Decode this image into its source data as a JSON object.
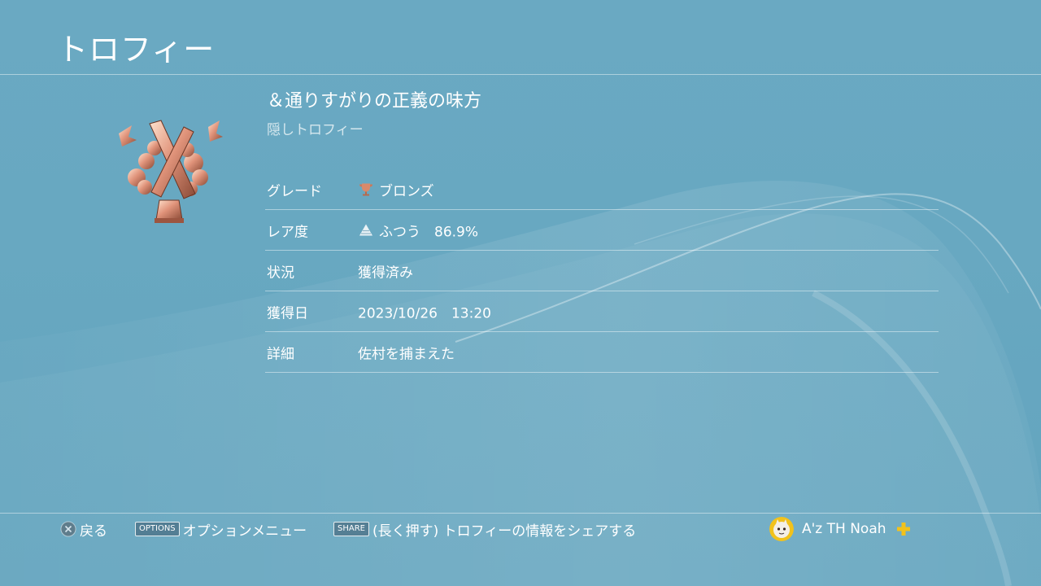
{
  "header": {
    "title": "トロフィー"
  },
  "trophy": {
    "name": "＆通りすがりの正義の味方",
    "subtitle": "隠しトロフィー",
    "details": [
      {
        "label": "グレード",
        "value": "ブロンズ",
        "icon": "bronze-trophy-icon"
      },
      {
        "label": "レア度",
        "value": "ふつう　86.9%",
        "icon": "rarity-pyramid-icon"
      },
      {
        "label": "状況",
        "value": "獲得済み"
      },
      {
        "label": "獲得日",
        "value": "2023/10/26　13:20"
      },
      {
        "label": "詳細",
        "value": "佐村を捕まえた"
      }
    ]
  },
  "footer": {
    "back_label": "戻る",
    "options_chip": "OPTIONS",
    "options_label": "オプションメニュー",
    "share_chip": "SHARE",
    "share_label": "(長く押す) トロフィーの情報をシェアする",
    "user_name": "A'z TH Noah"
  },
  "colors": {
    "background": "#68a8c1",
    "bronze": "#d9896a",
    "plus_gold": "#f2c21b"
  }
}
